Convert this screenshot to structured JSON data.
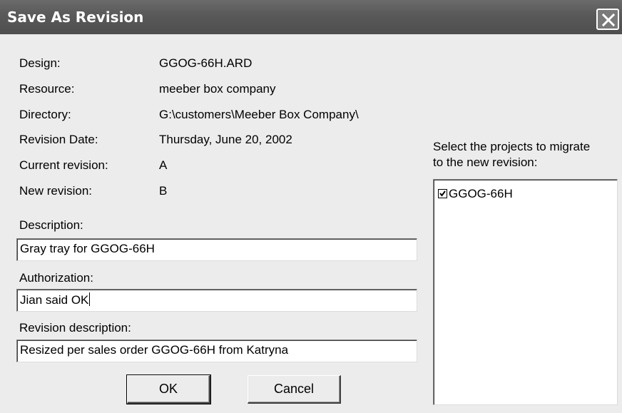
{
  "window": {
    "title": "Save As Revision"
  },
  "info": {
    "design_label": "Design:",
    "design_value": "GGOG-66H.ARD",
    "resource_label": "Resource:",
    "resource_value": "meeber box company",
    "directory_label": "Directory:",
    "directory_value": "G:\\customers\\Meeber Box Company\\",
    "revision_date_label": "Revision Date:",
    "revision_date_value": "Thursday, June 20, 2002",
    "current_revision_label": "Current revision:",
    "current_revision_value": "A",
    "new_revision_label": "New revision:",
    "new_revision_value": "B"
  },
  "form": {
    "description_label": "Description:",
    "description_value": "Gray tray for GGOG-66H",
    "authorization_label": "Authorization:",
    "authorization_value": "Jian said OK",
    "revision_description_label": "Revision description:",
    "revision_description_value": "Resized per sales order GGOG-66H from Katryna"
  },
  "projects": {
    "prompt_line1": "Select the projects to migrate",
    "prompt_line2": "to the new revision:",
    "items": [
      {
        "label": "GGOG-66H",
        "checked": true
      }
    ]
  },
  "buttons": {
    "ok_label": "OK",
    "cancel_label": "Cancel"
  },
  "icons": {
    "close": "close-icon",
    "checkmark": "checkmark-icon"
  }
}
